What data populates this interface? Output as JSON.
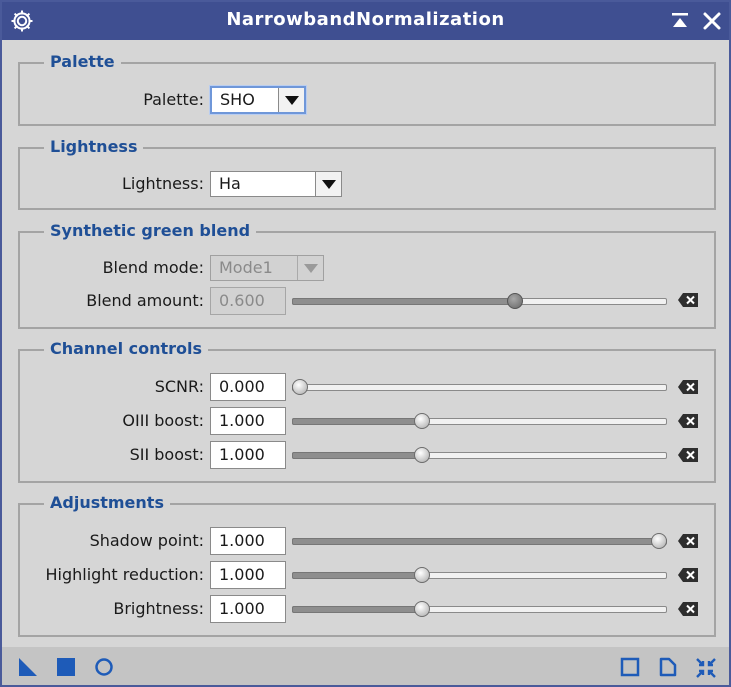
{
  "window": {
    "title": "NarrowbandNormalization"
  },
  "groups": {
    "palette": {
      "title": "Palette",
      "label": "Palette:",
      "value": "SHO"
    },
    "lightness": {
      "title": "Lightness",
      "label": "Lightness:",
      "value": "Ha"
    },
    "synthetic_green": {
      "title": "Synthetic green blend",
      "blend_mode_label": "Blend mode:",
      "blend_mode_value": "Mode1",
      "blend_amount_label": "Blend amount:",
      "blend_amount_value": "0.600",
      "blend_amount_fraction": 0.6
    },
    "channel_controls": {
      "title": "Channel controls",
      "rows": [
        {
          "label": "SCNR:",
          "value": "0.000",
          "fraction": 0.0
        },
        {
          "label": "OIII boost:",
          "value": "1.000",
          "fraction": 0.34
        },
        {
          "label": "SII boost:",
          "value": "1.000",
          "fraction": 0.34
        }
      ]
    },
    "adjustments": {
      "title": "Adjustments",
      "rows": [
        {
          "label": "Shadow point:",
          "value": "1.000",
          "fraction": 1.0
        },
        {
          "label": "Highlight reduction:",
          "value": "1.000",
          "fraction": 0.34
        },
        {
          "label": "Brightness:",
          "value": "1.000",
          "fraction": 0.34
        }
      ]
    }
  },
  "colors": {
    "titlebar": "#3f4f91",
    "accent_text": "#1f4f96",
    "icon_blue": "#1e5bb8",
    "background": "#d6d6d6"
  },
  "icons": {
    "titlebar_left": "gear-icon",
    "titlebar_right": [
      "shade-icon",
      "close-icon"
    ],
    "bottom_left": [
      "new-instance-triangle-icon",
      "apply-global-square-icon",
      "preview-circle-icon"
    ],
    "bottom_right": [
      "browse-documentation-icon",
      "edit-instance-icon",
      "reset-icon"
    ]
  }
}
